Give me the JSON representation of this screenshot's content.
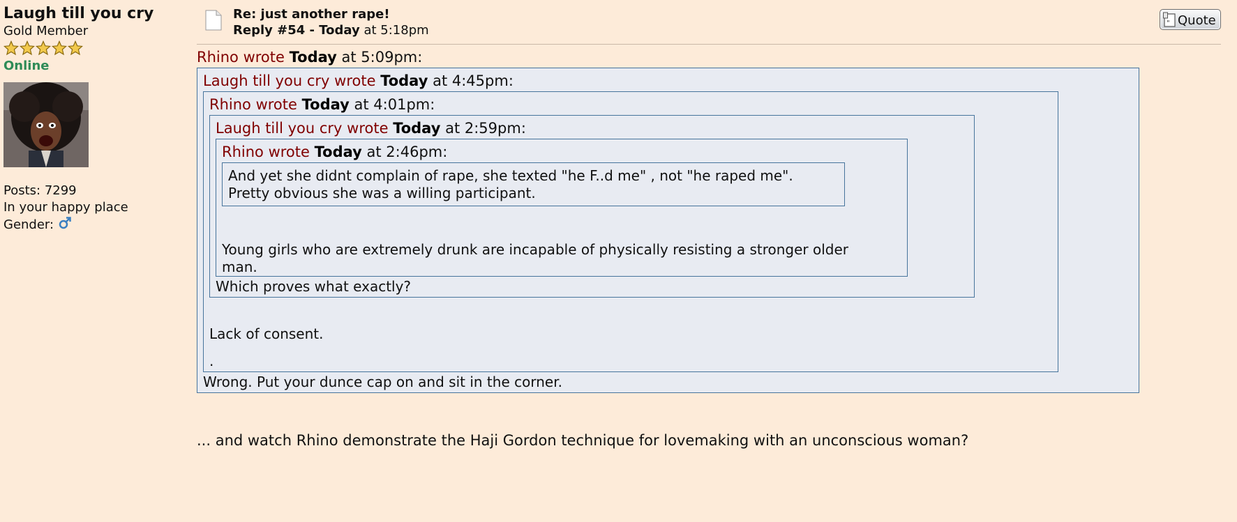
{
  "sidebar": {
    "username": "Laugh till you cry",
    "rank": "Gold Member",
    "status": "Online",
    "posts": "Posts: 7299",
    "location": "In your happy place",
    "gender_label": "Gender:",
    "star_count": 5,
    "star_color": "#f2c94c"
  },
  "post": {
    "subject": "Re: just another rape!",
    "reply_number": "Reply #54 - Today",
    "reply_time": "at 5:18pm",
    "quote_button": "Quote",
    "q1": {
      "author": "Rhino wrote",
      "day": "Today",
      "time": "at 5:09pm:"
    },
    "q2": {
      "author": "Laugh till you cry wrote",
      "day": "Today",
      "time": "at 4:45pm:"
    },
    "q3": {
      "author": "Rhino wrote",
      "day": "Today",
      "time": "at 4:01pm:"
    },
    "q4": {
      "author": "Laugh till you cry wrote",
      "day": "Today",
      "time": "at 2:59pm:"
    },
    "q5": {
      "author": "Rhino wrote",
      "day": "Today",
      "time": "at 2:46pm:"
    },
    "q6_line1": "And yet she didnt complain of rape, she texted \"he F..d me\" , not \"he raped me\".",
    "q6_line2": "Pretty obvious she was a willing participant.",
    "q5_body_line1": "Young girls who are extremely drunk are incapable of physically resisting a stronger older",
    "q5_body_line2": "man.",
    "q4_body": "Which proves what exactly?",
    "q3_body": "Lack of consent.",
    "q3_dot": ".",
    "q2_body": "Wrong. Put your dunce cap on and sit in the corner.",
    "main_body": "... and watch Rhino demonstrate the Haji Gordon technique for lovemaking with an unconscious woman?"
  },
  "colors": {
    "background": "#fdebd9",
    "quote_bg": "#e8ebf2",
    "quote_border": "#47749c",
    "author": "#800000",
    "online": "#2e8b57"
  }
}
